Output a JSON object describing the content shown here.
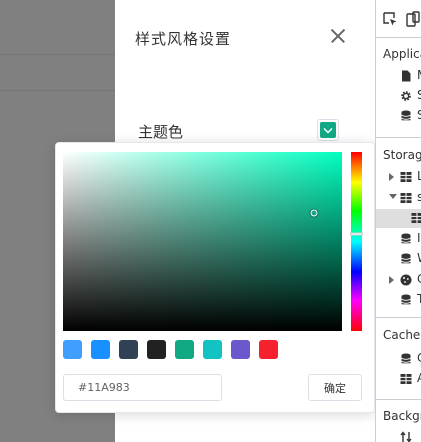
{
  "theme": {
    "accent": "#11A983",
    "hue_color": "#00ffbf"
  },
  "drawer": {
    "title": "样式风格设置",
    "theme_color_label": "主题色"
  },
  "color_picker": {
    "hex_value": "#11A983",
    "confirm_label": "确定",
    "hue_level": 0.46,
    "saturation": 0.9,
    "brightness": 0.66,
    "presets": [
      "#409EFF",
      "#1890FF",
      "#304156",
      "#212121",
      "#11A983",
      "#13C2C2",
      "#6959CD",
      "#F5222D"
    ]
  },
  "devtools": {
    "application_heading": "Applica",
    "storage_heading": "Storage",
    "cache_heading": "Cache",
    "background_heading": "Backgr",
    "application_items": [
      {
        "icon": "file-icon",
        "text": "M"
      },
      {
        "icon": "gear-icon",
        "text": "S"
      },
      {
        "icon": "database-icon",
        "text": "S"
      }
    ],
    "storage_items": [
      {
        "icon": "grid-icon",
        "text": "L",
        "expander": "collapsed"
      },
      {
        "icon": "grid-icon",
        "text": "s",
        "expander": "expanded"
      },
      {
        "icon": "grid-icon",
        "text": "",
        "expander": "none",
        "selected": true
      },
      {
        "icon": "database-icon",
        "text": "I",
        "expander": "none"
      },
      {
        "icon": "database-icon",
        "text": "W",
        "expander": "none"
      },
      {
        "icon": "cookie-icon",
        "text": "C",
        "expander": "collapsed"
      },
      {
        "icon": "database-icon",
        "text": "T",
        "expander": "none"
      }
    ],
    "cache_items": [
      {
        "icon": "database-icon",
        "text": "C"
      },
      {
        "icon": "grid-icon",
        "text": "A"
      }
    ]
  }
}
